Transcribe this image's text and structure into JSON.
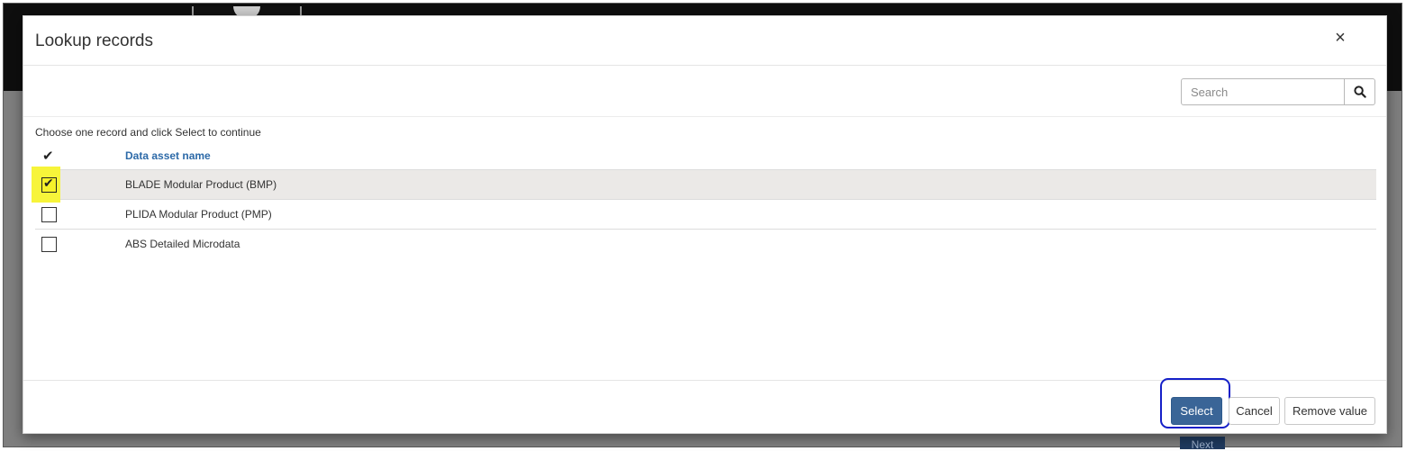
{
  "background": {
    "next_label": "Next"
  },
  "modal": {
    "title": "Lookup records",
    "close_glyph": "×",
    "search": {
      "placeholder": "Search",
      "value": ""
    },
    "instructions": "Choose one record and click Select to continue",
    "grid": {
      "header_check_glyph": "✔",
      "column_header": "Data asset name",
      "rows": [
        {
          "name": "BLADE Modular Product (BMP)",
          "checked": true
        },
        {
          "name": "PLIDA Modular Product (PMP)",
          "checked": false
        },
        {
          "name": "ABS Detailed Microdata",
          "checked": false
        }
      ]
    },
    "footer": {
      "select_label": "Select",
      "cancel_label": "Cancel",
      "remove_label": "Remove value"
    }
  },
  "colors": {
    "accent_blue": "#3a6597",
    "header_link_blue": "#2d6aa8",
    "highlight_yellow": "#f7f43a",
    "annotation_ring": "#1520c8",
    "selected_row_bg": "#ebe9e7"
  }
}
